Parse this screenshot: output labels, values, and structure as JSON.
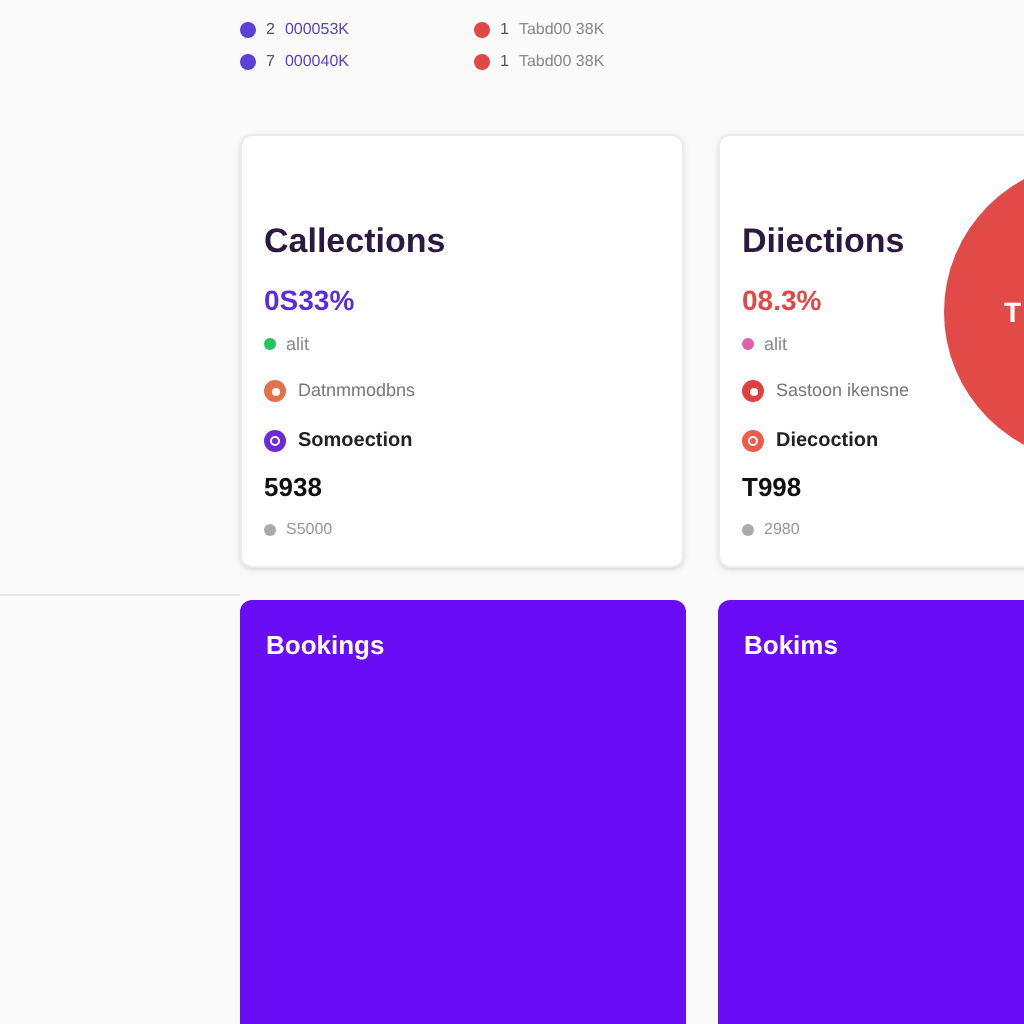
{
  "top_list": [
    {
      "left": {
        "index": "2",
        "text": "000053K",
        "color": "#5b3fd6"
      },
      "right": {
        "index": "1",
        "text": "Tabd00 38K",
        "color": "#e04848"
      }
    },
    {
      "left": {
        "index": "7",
        "text": "000040K",
        "color": "#5b3fd6"
      },
      "right": {
        "index": "1",
        "text": "Tabd00 38K",
        "color": "#e04848"
      }
    }
  ],
  "cards": [
    {
      "title": "Callections",
      "percent": {
        "text": "0S33%",
        "color": "#5b2be0"
      },
      "status": {
        "text": "alit",
        "color": "#22c55e"
      },
      "row": {
        "text": "Datnmmodbns",
        "color": "#e0714a"
      },
      "section": {
        "text": "Somoection",
        "color": "#6d28d9"
      },
      "value": "5938",
      "footnote": "S5000"
    },
    {
      "title": "Diiections",
      "percent": {
        "text": "08.3%",
        "color": "#e04848"
      },
      "status": {
        "text": "alit",
        "color": "#e05fb0"
      },
      "row": {
        "text": "Sastoon ikensne",
        "color": "#e04040"
      },
      "section": {
        "text": "Diecoction",
        "color": "#ef5a4a"
      },
      "value": "T998",
      "footnote": "2980",
      "bubble": "T"
    }
  ],
  "panels": [
    {
      "title": "Bookings"
    },
    {
      "title": "Bokims"
    }
  ]
}
